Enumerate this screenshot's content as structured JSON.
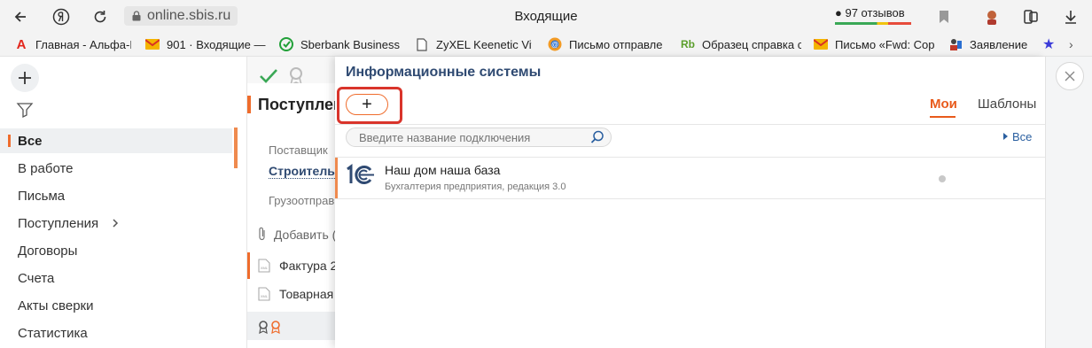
{
  "browser": {
    "url": "online.sbis.ru",
    "title": "Входящие",
    "reviews": "97 отзывов"
  },
  "bookmarks": [
    {
      "label": "Главная - Альфа-Б",
      "icon": "alfa-icon",
      "color": "#e3261c"
    },
    {
      "label": "901 · Входящие —",
      "icon": "gmail-icon",
      "color": "#d93025"
    },
    {
      "label": "Sberbank Business",
      "icon": "sber-icon",
      "color": "#21a038"
    },
    {
      "label": "ZyXEL Keenetic Viv",
      "icon": "document-icon",
      "color": "#555555"
    },
    {
      "label": "Письмо отправле",
      "icon": "mail-at-icon",
      "color": "#2a6fd1"
    },
    {
      "label": "Образец справка с",
      "icon": "rub-icon",
      "color": "#5a9e2a"
    },
    {
      "label": "Письмо «Fwd: Cop",
      "icon": "gmail-icon",
      "color": "#d93025"
    },
    {
      "label": "Заявление",
      "icon": "user-doc-icon",
      "color": "#c0392b"
    }
  ],
  "sidebar": {
    "items": [
      "Все",
      "В работе",
      "Письма",
      "Поступления",
      "Договоры",
      "Счета",
      "Акты сверки",
      "Статистика"
    ]
  },
  "middle": {
    "header": "Поступлен",
    "supplier_label": "Поставщик",
    "supplier_value": "Строительн",
    "shipper_label": "Грузоотправ",
    "add_label": "Добавить (",
    "docs": [
      "Фактура 2",
      "Товарная"
    ]
  },
  "modal": {
    "title": "Информационные системы",
    "add_label": "+",
    "tabs": [
      "Мои",
      "Шаблоны"
    ],
    "search_placeholder": "Введите название подключения",
    "all_link": "Все",
    "rows": [
      {
        "name": "Наш дом наша база",
        "subtitle": "Бухгалтерия предприятия, редакция 3.0"
      }
    ]
  },
  "colors": {
    "accent": "#ef6c2c",
    "highlight": "#d9342b",
    "title": "#2f4a72",
    "link": "#2a5fa0"
  }
}
